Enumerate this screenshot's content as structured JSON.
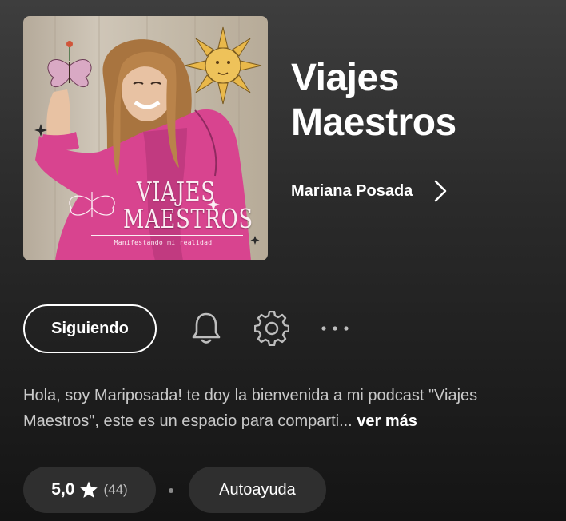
{
  "podcast": {
    "title": "Viajes Maestros",
    "author": "Mariana Posada",
    "cover": {
      "title": "VIAJES MAESTROS",
      "subtitle": "Manifestando mi realidad"
    }
  },
  "actions": {
    "follow_label": "Siguiendo",
    "icons": [
      "bell-icon",
      "gear-icon",
      "more-options-icon"
    ]
  },
  "description": {
    "text": "Hola, soy Mariposada! te doy la bienvenida a mi podcast \"Viajes Maestros\", este es un espacio para comparti...",
    "more_label": "ver más"
  },
  "meta": {
    "rating": "5,0",
    "rating_count": "(44)",
    "category": "Autoayuda"
  },
  "colors": {
    "background": "#121212",
    "text_primary": "#ffffff",
    "text_secondary": "#c9c9c9",
    "chip": "#2f2f2f",
    "cover_accent": "#e23f95"
  }
}
